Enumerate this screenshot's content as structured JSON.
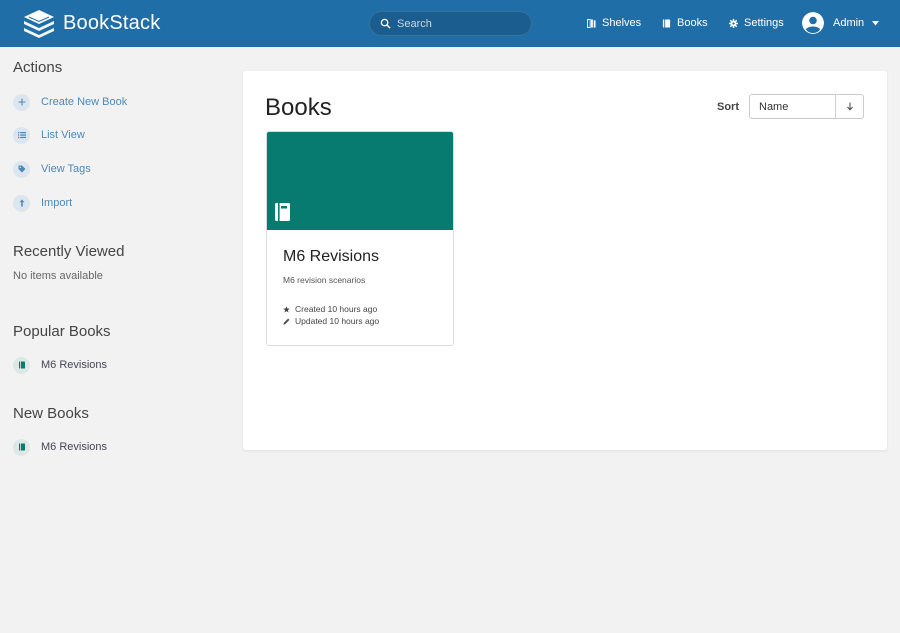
{
  "header": {
    "brand": "BookStack",
    "search_placeholder": "Search",
    "nav": [
      {
        "label": "Shelves",
        "icon": "shelves-icon"
      },
      {
        "label": "Books",
        "icon": "book-icon"
      },
      {
        "label": "Settings",
        "icon": "gear-icon"
      }
    ],
    "user": "Admin"
  },
  "sidebar": {
    "actions_title": "Actions",
    "actions": [
      {
        "label": "Create New Book",
        "icon": "plus-icon"
      },
      {
        "label": "List View",
        "icon": "list-icon"
      },
      {
        "label": "View Tags",
        "icon": "tag-icon"
      },
      {
        "label": "Import",
        "icon": "upload-icon"
      }
    ],
    "recent_title": "Recently Viewed",
    "recent_empty": "No items available",
    "popular_title": "Popular Books",
    "popular": [
      {
        "label": "M6 Revisions"
      }
    ],
    "new_title": "New Books",
    "new": [
      {
        "label": "M6 Revisions"
      }
    ]
  },
  "main": {
    "title": "Books",
    "sort_label": "Sort",
    "sort_value": "Name",
    "books": [
      {
        "name": "M6 Revisions",
        "description": "M6 revision scenarios",
        "created": "Created 10 hours ago",
        "updated": "Updated 10 hours ago",
        "cover_color": "#077b70"
      }
    ]
  },
  "colors": {
    "header": "#206ea7",
    "link": "#4e89b8",
    "book": "#077b70"
  }
}
